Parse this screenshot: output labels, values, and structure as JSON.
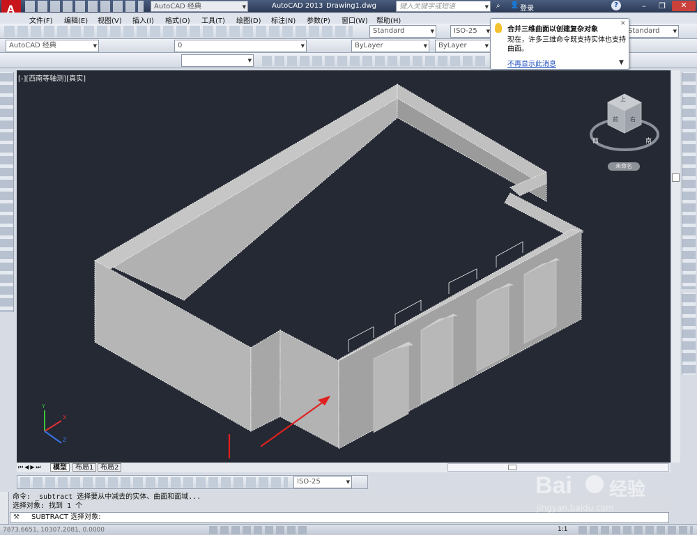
{
  "app": {
    "title": "AutoCAD 2013",
    "file": "Drawing1.dwg",
    "workspace": "AutoCAD 经典",
    "search_placeholder": "键入关键字或短语",
    "login": "登录"
  },
  "menu": [
    "文件(F)",
    "编辑(E)",
    "视图(V)",
    "插入(I)",
    "格式(O)",
    "工具(T)",
    "绘图(D)",
    "标注(N)",
    "参数(P)",
    "窗口(W)",
    "帮助(H)"
  ],
  "toolbar": {
    "text_style": "Standard",
    "dim_style": "ISO-25",
    "table_style": "Standard",
    "workspace_combo": "AutoCAD 经典",
    "layer": "0",
    "color": "ByLayer",
    "linetype": "ByLayer",
    "dim_style2": "ISO-25"
  },
  "tooltip": {
    "title": "合并三维曲面以创建复杂对象",
    "body": "现在，许多三维命令既支持实体也支持曲面。",
    "link": "不再显示此消息"
  },
  "viewport": {
    "label": "[-][西南等轴测][真实]",
    "bg": "#242933",
    "accent": "#e02020"
  },
  "viewcube": {
    "face_top": "上",
    "face_left": "前",
    "face_right": "右",
    "west": "西",
    "south": "南",
    "unnamed": "未命名"
  },
  "ucs": {
    "x": "X",
    "y": "Y",
    "z": "Z"
  },
  "tabs": [
    "模型",
    "布局1",
    "布局2"
  ],
  "command": {
    "line1": "命令: _subtract 选择要从中减去的实体、曲面和面域...",
    "line2": "选择对象: 找到 1 个",
    "prompt": "SUBTRACT 选择对象:"
  },
  "status": {
    "coords": "7873.6651, 10307.2081, 0.0000",
    "scale": "1:1"
  },
  "watermark": {
    "brand": "Bai",
    "cn": "经验",
    "url": "jingyan.baidu.com"
  }
}
